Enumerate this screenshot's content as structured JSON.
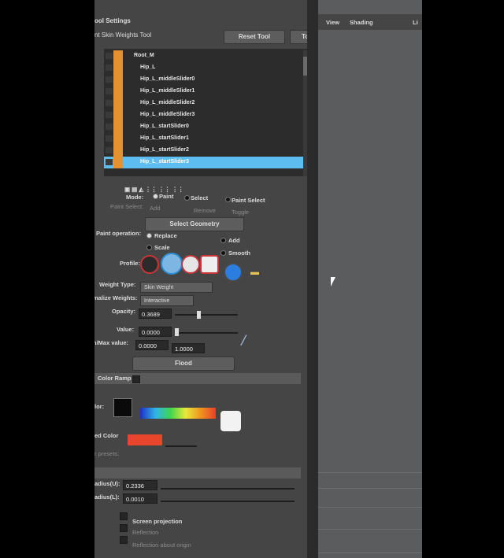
{
  "toolbar": {
    "icons": [
      "toolbar-tool-icon"
    ]
  },
  "panel": {
    "title": "ool Settings",
    "subtitle": "nt Skin Weights Tool",
    "reset_label": "Reset Tool",
    "help_label": "Tool Help"
  },
  "viewport_menu": {
    "view": "View",
    "shading": "Shading",
    "cut": "Li"
  },
  "tree": {
    "rows": [
      "Root_M",
      "Hip_L",
      "Hip_L_middleSlider0",
      "Hip_L_middleSlider1",
      "Hip_L_middleSlider2",
      "Hip_L_middleSlider3",
      "Hip_L_startSlider0",
      "Hip_L_startSlider1",
      "Hip_L_startSlider2",
      "Hip_L_startSlider3"
    ]
  },
  "mode": {
    "label": "Mode:",
    "paint": "Paint",
    "select": "Select",
    "paint_select": "Paint Select",
    "paint_select_label": "Paint Select:",
    "add": "Add",
    "remove": "Remove",
    "toggle": "Toggle"
  },
  "select_geometry": "Select Geometry",
  "paint_op": {
    "label": "Paint operation:",
    "replace": "Replace",
    "add": "Add",
    "scale": "Scale",
    "smooth": "Smooth"
  },
  "profile": {
    "label": "Profile:"
  },
  "weight_type": {
    "label": "Weight Type:",
    "value": "Skin Weight"
  },
  "normalize": {
    "label": "malize Weights:",
    "value": "Interactive"
  },
  "opacity": {
    "label": "Opacity:",
    "value": "0.3689",
    "level": 0.37
  },
  "value_field": {
    "label": "Value:",
    "value": "0.0000",
    "level": 0.0
  },
  "minmax": {
    "label": "n/Max value:",
    "min": "0.0000",
    "max": "1.0000"
  },
  "flood": "Flood",
  "color_ramp": {
    "label": "Color Ramp",
    "color_label": "lor:",
    "ed_color": "ed Color",
    "presets": "r presets:"
  },
  "brush": {
    "v1_label": "adius(U):",
    "v1": "0.2336",
    "v2_label": "adius(L):",
    "v2": "0.0010",
    "screen_projection": "Screen projection",
    "reflection": "Reflection",
    "reflection_about": "Reflection about origin"
  },
  "colors": {
    "tree_orange": "#e49132",
    "selection_blue": "#5dbdf0",
    "ed_color": "#e8462c"
  }
}
